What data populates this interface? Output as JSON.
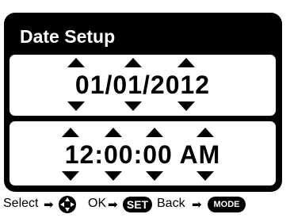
{
  "screen": {
    "title": "Date Setup",
    "date_value": "01/01/2012",
    "time_value": "12:00:00 AM"
  },
  "help_bar": {
    "select_label": "Select",
    "ok_label": "OK",
    "ok_key": "SET",
    "back_label": "Back",
    "back_key": "MODE",
    "arrow_glyph": "➡"
  },
  "icons": {
    "field_up": "triangle-up-icon",
    "field_down": "triangle-down-icon",
    "select_key": "dpad-icon"
  },
  "colors": {
    "frame": "#000000",
    "panel": "#ffffff",
    "text": "#000000"
  }
}
